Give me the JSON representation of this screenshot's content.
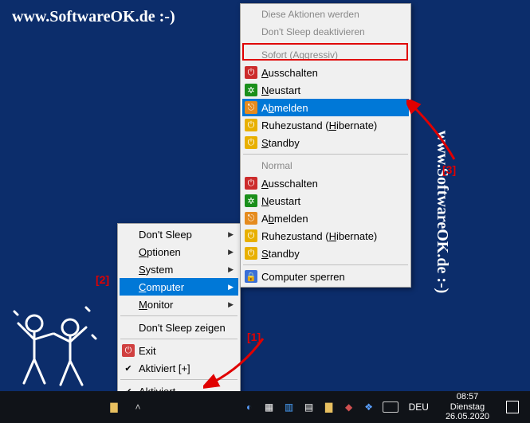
{
  "watermark": "www.SoftwareOK.de :-)",
  "menu1": {
    "items": [
      {
        "label": "Don't Sleep",
        "sub": true
      },
      {
        "label": "Optionen",
        "sub": true
      },
      {
        "label": "System",
        "sub": true
      },
      {
        "label": "Computer",
        "sub": true,
        "hl": true
      },
      {
        "label": "Monitor",
        "sub": true
      }
    ],
    "show": "Don't Sleep zeigen",
    "exit": "Exit",
    "activated_plus": "Aktiviert [+]",
    "activated": "Aktiviert"
  },
  "menu2": {
    "disabled1": "Diese Aktionen werden",
    "disabled2": "Don't Sleep deaktivieren",
    "header_aggr": "Sofort (Aggressiv)",
    "header_norm": "Normal",
    "actions": {
      "shutdown": "Ausschalten",
      "restart": "Neustart",
      "logoff": "Abmelden",
      "hibernate": "Ruhezustand (Hibernate)",
      "standby": "Standby"
    },
    "lock": "Computer sperren"
  },
  "taskbar": {
    "lang": "DEU",
    "time": "08:57",
    "day": "Dienstag",
    "date": "26.05.2020"
  },
  "annotations": {
    "a1": "[1]",
    "a2": "[2]",
    "a3": "[3]"
  }
}
